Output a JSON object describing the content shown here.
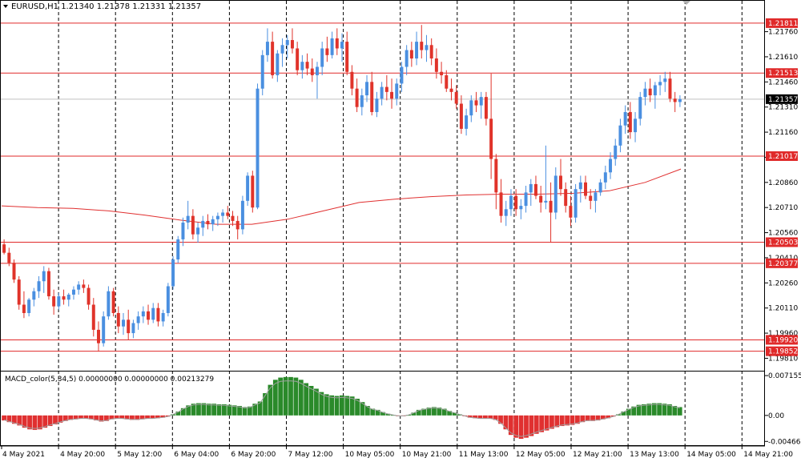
{
  "header": {
    "symbol_line": "EURUSD,H1  1.21340 1.21378 1.21331 1.21357",
    "macd_line": "MACD_color(5,34,5) 0.00000000 0.00000000 0.00213279"
  },
  "colors": {
    "bull": "#4a8fe0",
    "bear": "#e0332a",
    "level_line": "#e02a2a",
    "ma_line": "#e03030",
    "macd_pos": "#2a8a2a",
    "macd_neg": "#e03030",
    "grid": "#000000",
    "label_bg": "#e02a2a"
  },
  "icons": {
    "dropdown": "triangle-down-icon",
    "scroll_marker": "triangle-down-icon"
  },
  "chart_data": {
    "type": "candlestick",
    "symbol": "EURUSD",
    "timeframe": "H1",
    "ohlc_header": {
      "open": 1.2134,
      "high": 1.21378,
      "low": 1.21331,
      "close": 1.21357
    },
    "ylim": [
      1.1975,
      1.2193
    ],
    "y_ticks": [
      "1.21760",
      "1.21610",
      "1.21460",
      "1.21310",
      "1.21160",
      "1.21010",
      "1.20860",
      "1.20710",
      "1.20560",
      "1.20410",
      "1.20260",
      "1.20110",
      "1.19960",
      "1.19810"
    ],
    "y_tick_values": [
      1.2176,
      1.2161,
      1.2146,
      1.2131,
      1.2116,
      1.2101,
      1.2086,
      1.2071,
      1.2056,
      1.2041,
      1.2026,
      1.2011,
      1.1996,
      1.1981
    ],
    "x_ticks": [
      "4 May 2021",
      "4 May 20:00",
      "5 May 12:00",
      "6 May 04:00",
      "6 May 20:00",
      "7 May 12:00",
      "10 May 05:00",
      "10 May 21:00",
      "11 May 13:00",
      "12 May 05:00",
      "12 May 21:00",
      "13 May 13:00",
      "14 May 05:00",
      "14 May 21:00"
    ],
    "horizontal_levels": [
      {
        "label": "1.21811",
        "value": 1.21811
      },
      {
        "label": "1.21513",
        "value": 1.21513
      },
      {
        "label": "1.21017",
        "value": 1.21017
      },
      {
        "label": "1.20503",
        "value": 1.20503
      },
      {
        "label": "1.20377",
        "value": 1.20377
      },
      {
        "label": "1.19920",
        "value": 1.1992
      },
      {
        "label": "1.19852",
        "value": 1.19852
      }
    ],
    "current_price": {
      "label": "1.21357",
      "value": 1.21357
    },
    "ma_points": [
      1.2072,
      1.2071,
      1.20705,
      1.2069,
      1.20665,
      1.20635,
      1.2061,
      1.2061,
      1.2064,
      1.2069,
      1.2074,
      1.2076,
      1.20775,
      1.20785,
      1.2079,
      1.2079,
      1.20795,
      1.2081,
      1.2086,
      1.2094
    ],
    "candles": [
      [
        1.2049,
        1.2052,
        1.2043,
        1.2044
      ],
      [
        1.2044,
        1.2047,
        1.2036,
        1.2038
      ],
      [
        1.2038,
        1.204,
        1.2026,
        1.2028
      ],
      [
        1.2028,
        1.203,
        1.201,
        1.2013
      ],
      [
        1.2013,
        1.2021,
        1.2005,
        1.2008
      ],
      [
        1.2008,
        1.2017,
        1.2006,
        1.2016
      ],
      [
        1.2016,
        1.2023,
        1.2012,
        1.2021
      ],
      [
        1.2021,
        1.203,
        1.2017,
        1.2027
      ],
      [
        1.2027,
        1.2036,
        1.202,
        1.2033
      ],
      [
        1.2033,
        1.2035,
        1.2016,
        1.2018
      ],
      [
        1.2018,
        1.2022,
        1.2007,
        1.2012
      ],
      [
        1.2012,
        1.202,
        1.201,
        1.2018
      ],
      [
        1.2018,
        1.2022,
        1.2013,
        1.2016
      ],
      [
        1.2016,
        1.202,
        1.2012,
        1.2019
      ],
      [
        1.2019,
        1.2024,
        1.2016,
        1.2022
      ],
      [
        1.2022,
        1.2027,
        1.2019,
        1.2025
      ],
      [
        1.2025,
        1.2028,
        1.202,
        1.2023
      ],
      [
        1.2023,
        1.2025,
        1.201,
        1.2013
      ],
      [
        1.2013,
        1.2017,
        1.1994,
        1.1998
      ],
      [
        1.1998,
        1.2003,
        1.1985,
        1.199
      ],
      [
        1.199,
        1.2009,
        1.1988,
        1.2006
      ],
      [
        1.2006,
        1.2024,
        1.2004,
        1.2021
      ],
      [
        1.2021,
        1.2023,
        1.2006,
        1.2008
      ],
      [
        1.2008,
        1.2012,
        1.1996,
        1.2
      ],
      [
        1.2,
        1.2008,
        1.1995,
        1.2004
      ],
      [
        1.2004,
        1.201,
        1.1992,
        1.1996
      ],
      [
        1.1996,
        1.2004,
        1.1993,
        1.2002
      ],
      [
        1.2002,
        1.2009,
        1.1998,
        1.2006
      ],
      [
        1.2006,
        1.2012,
        1.2002,
        1.2009
      ],
      [
        1.2009,
        1.2013,
        1.2001,
        1.2004
      ],
      [
        1.2004,
        1.2014,
        1.2002,
        1.2011
      ],
      [
        1.2011,
        1.2014,
        1.2,
        1.2003
      ],
      [
        1.2003,
        1.201,
        1.2,
        1.2008
      ],
      [
        1.2008,
        1.2026,
        1.2006,
        1.2024
      ],
      [
        1.2024,
        1.2042,
        1.2022,
        1.204
      ],
      [
        1.204,
        1.2054,
        1.2038,
        1.2052
      ],
      [
        1.2052,
        1.2065,
        1.2048,
        1.2062
      ],
      [
        1.2062,
        1.2075,
        1.2058,
        1.2066
      ],
      [
        1.2066,
        1.207,
        1.2052,
        1.2055
      ],
      [
        1.2055,
        1.2062,
        1.205,
        1.2059
      ],
      [
        1.2059,
        1.2066,
        1.2054,
        1.2063
      ],
      [
        1.2063,
        1.2067,
        1.2058,
        1.2061
      ],
      [
        1.2061,
        1.2066,
        1.2057,
        1.2064
      ],
      [
        1.2064,
        1.2068,
        1.206,
        1.2066
      ],
      [
        1.2066,
        1.207,
        1.2062,
        1.2068
      ],
      [
        1.2068,
        1.2072,
        1.2064,
        1.2066
      ],
      [
        1.2066,
        1.2069,
        1.206,
        1.2063
      ],
      [
        1.2063,
        1.2066,
        1.2052,
        1.2058
      ],
      [
        1.2058,
        1.2078,
        1.2055,
        1.2075
      ],
      [
        1.2075,
        1.2092,
        1.2072,
        1.209
      ],
      [
        1.209,
        1.2093,
        1.2068,
        1.2071
      ],
      [
        1.2071,
        1.2145,
        1.207,
        1.2142
      ],
      [
        1.2142,
        1.2165,
        1.2138,
        1.2162
      ],
      [
        1.2162,
        1.2178,
        1.2158,
        1.217
      ],
      [
        1.217,
        1.2176,
        1.2148,
        1.215
      ],
      [
        1.215,
        1.2165,
        1.2146,
        1.2163
      ],
      [
        1.2163,
        1.2172,
        1.2155,
        1.2168
      ],
      [
        1.2168,
        1.2174,
        1.216,
        1.2171
      ],
      [
        1.2171,
        1.2178,
        1.2163,
        1.2166
      ],
      [
        1.2166,
        1.217,
        1.215,
        1.2153
      ],
      [
        1.2153,
        1.2162,
        1.2148,
        1.2158
      ],
      [
        1.2158,
        1.2163,
        1.215,
        1.2154
      ],
      [
        1.2154,
        1.216,
        1.2146,
        1.215
      ],
      [
        1.215,
        1.2158,
        1.2136,
        1.2155
      ],
      [
        1.2155,
        1.217,
        1.215,
        1.2166
      ],
      [
        1.2166,
        1.2173,
        1.2158,
        1.2162
      ],
      [
        1.2162,
        1.2176,
        1.216,
        1.2172
      ],
      [
        1.2172,
        1.2178,
        1.2162,
        1.2166
      ],
      [
        1.2166,
        1.2175,
        1.2158,
        1.217
      ],
      [
        1.217,
        1.2176,
        1.215,
        1.2152
      ],
      [
        1.2152,
        1.2156,
        1.2138,
        1.2142
      ],
      [
        1.2142,
        1.2148,
        1.2128,
        1.2131
      ],
      [
        1.2131,
        1.2142,
        1.2126,
        1.2138
      ],
      [
        1.2138,
        1.215,
        1.2134,
        1.2146
      ],
      [
        1.2146,
        1.2152,
        1.2126,
        1.2128
      ],
      [
        1.2128,
        1.214,
        1.2125,
        1.2136
      ],
      [
        1.2136,
        1.2146,
        1.2132,
        1.2143
      ],
      [
        1.2143,
        1.215,
        1.2135,
        1.214
      ],
      [
        1.214,
        1.2148,
        1.213,
        1.2136
      ],
      [
        1.2136,
        1.2148,
        1.2132,
        1.2145
      ],
      [
        1.2145,
        1.2158,
        1.214,
        1.2155
      ],
      [
        1.2155,
        1.2168,
        1.215,
        1.2165
      ],
      [
        1.2165,
        1.217,
        1.2155,
        1.216
      ],
      [
        1.216,
        1.2176,
        1.2156,
        1.217
      ],
      [
        1.217,
        1.218,
        1.216,
        1.2165
      ],
      [
        1.2165,
        1.2174,
        1.2158,
        1.2168
      ],
      [
        1.2168,
        1.2172,
        1.2156,
        1.216
      ],
      [
        1.216,
        1.2166,
        1.2148,
        1.2152
      ],
      [
        1.2152,
        1.2158,
        1.2145,
        1.215
      ],
      [
        1.215,
        1.2153,
        1.214,
        1.2142
      ],
      [
        1.2142,
        1.2148,
        1.2135,
        1.214
      ],
      [
        1.214,
        1.2144,
        1.213,
        1.2133
      ],
      [
        1.2133,
        1.2138,
        1.2115,
        1.2118
      ],
      [
        1.2118,
        1.213,
        1.2114,
        1.2126
      ],
      [
        1.2126,
        1.2138,
        1.2122,
        1.2135
      ],
      [
        1.2135,
        1.214,
        1.2128,
        1.2132
      ],
      [
        1.2132,
        1.214,
        1.2124,
        1.2137
      ],
      [
        1.2137,
        1.214,
        1.212,
        1.2124
      ],
      [
        1.2124,
        1.2151,
        1.2088,
        1.21
      ],
      [
        1.21,
        1.2103,
        1.207,
        1.208
      ],
      [
        1.208,
        1.2088,
        1.2062,
        1.2066
      ],
      [
        1.2066,
        1.2075,
        1.206,
        1.207
      ],
      [
        1.207,
        1.2082,
        1.2066,
        1.2078
      ],
      [
        1.2078,
        1.2082,
        1.2066,
        1.207
      ],
      [
        1.207,
        1.2076,
        1.2064,
        1.2072
      ],
      [
        1.2072,
        1.2084,
        1.2068,
        1.208
      ],
      [
        1.208,
        1.2088,
        1.2072,
        1.2085
      ],
      [
        1.2085,
        1.209,
        1.2076,
        1.2078
      ],
      [
        1.2078,
        1.2084,
        1.2068,
        1.2074
      ],
      [
        1.2074,
        1.2108,
        1.207,
        1.2075
      ],
      [
        1.2075,
        1.2086,
        1.205,
        1.2068
      ],
      [
        1.2068,
        1.2095,
        1.2064,
        1.209
      ],
      [
        1.209,
        1.21,
        1.2078,
        1.2082
      ],
      [
        1.2082,
        1.2086,
        1.2068,
        1.2072
      ],
      [
        1.2072,
        1.2078,
        1.206,
        1.2065
      ],
      [
        1.2065,
        1.2085,
        1.2062,
        1.2082
      ],
      [
        1.2082,
        1.209,
        1.2074,
        1.2086
      ],
      [
        1.2086,
        1.209,
        1.2076,
        1.2078
      ],
      [
        1.2078,
        1.2082,
        1.207,
        1.2075
      ],
      [
        1.2075,
        1.2082,
        1.2068,
        1.208
      ],
      [
        1.208,
        1.2088,
        1.2078,
        1.2086
      ],
      [
        1.2086,
        1.2096,
        1.2082,
        1.2092
      ],
      [
        1.2092,
        1.2104,
        1.2088,
        1.21
      ],
      [
        1.21,
        1.2112,
        1.2096,
        1.2108
      ],
      [
        1.2108,
        1.2124,
        1.2104,
        1.212
      ],
      [
        1.212,
        1.2132,
        1.2115,
        1.2128
      ],
      [
        1.2128,
        1.2134,
        1.2112,
        1.2116
      ],
      [
        1.2116,
        1.2128,
        1.211,
        1.2124
      ],
      [
        1.2124,
        1.214,
        1.212,
        1.2137
      ],
      [
        1.2137,
        1.2146,
        1.2132,
        1.2142
      ],
      [
        1.2142,
        1.2148,
        1.2134,
        1.2138
      ],
      [
        1.2138,
        1.2146,
        1.213,
        1.2144
      ],
      [
        1.2144,
        1.215,
        1.2138,
        1.2146
      ],
      [
        1.2146,
        1.2152,
        1.214,
        1.2148
      ],
      [
        1.2148,
        1.2152,
        1.2134,
        1.2136
      ],
      [
        1.2136,
        1.214,
        1.2128,
        1.2134
      ],
      [
        1.2134,
        1.2138,
        1.2131,
        1.21357
      ]
    ],
    "macd": {
      "label": "MACD_color(5,34,5)",
      "y_ticks": [
        "0.0071558",
        "0.00",
        "-0.0046658"
      ],
      "y_tick_values": [
        0.0071558,
        0,
        -0.0046658
      ],
      "ylim": [
        -0.0052,
        0.0076
      ],
      "histogram": [
        -0.0009,
        -0.0012,
        -0.0015,
        -0.0018,
        -0.0022,
        -0.0025,
        -0.0026,
        -0.0025,
        -0.0022,
        -0.0019,
        -0.0016,
        -0.0013,
        -0.001,
        -0.0008,
        -0.0007,
        -0.0006,
        -0.0006,
        -0.0007,
        -0.0009,
        -0.0011,
        -0.001,
        -0.0007,
        -0.0006,
        -0.0006,
        -0.0007,
        -0.0008,
        -0.0008,
        -0.0007,
        -0.0006,
        -0.0006,
        -0.0005,
        -0.0004,
        -0.0002,
        0.0002,
        0.0007,
        0.0013,
        0.0018,
        0.0021,
        0.0022,
        0.0022,
        0.0021,
        0.0021,
        0.002,
        0.002,
        0.0019,
        0.0018,
        0.0017,
        0.0015,
        0.0016,
        0.0021,
        0.0025,
        0.004,
        0.0055,
        0.0064,
        0.0068,
        0.0069,
        0.0069,
        0.0068,
        0.0064,
        0.0058,
        0.0053,
        0.0048,
        0.0042,
        0.0038,
        0.0036,
        0.0035,
        0.0036,
        0.0035,
        0.0034,
        0.003,
        0.0024,
        0.0017,
        0.0012,
        0.001,
        0.0006,
        0.0003,
        0.0001,
        -0.0001,
        -0.0001,
        0.0001,
        0.0005,
        0.001,
        0.0012,
        0.0014,
        0.0015,
        0.0014,
        0.0012,
        0.0008,
        0.0005,
        0.0002,
        -0.0001,
        -0.0004,
        -0.0005,
        -0.0006,
        -0.0006,
        -0.0006,
        -0.0008,
        -0.0015,
        -0.0025,
        -0.0035,
        -0.004,
        -0.0042,
        -0.004,
        -0.0037,
        -0.0033,
        -0.003,
        -0.0027,
        -0.0024,
        -0.0021,
        -0.0019,
        -0.0018,
        -0.0017,
        -0.0015,
        -0.0012,
        -0.001,
        -0.001,
        -0.0009,
        -0.0007,
        -0.0005,
        -0.0002,
        0.0002,
        0.0007,
        0.0012,
        0.0016,
        0.0019,
        0.002,
        0.0021,
        0.0022,
        0.0022,
        0.0021,
        0.002,
        0.0017,
        0.0015
      ]
    }
  }
}
